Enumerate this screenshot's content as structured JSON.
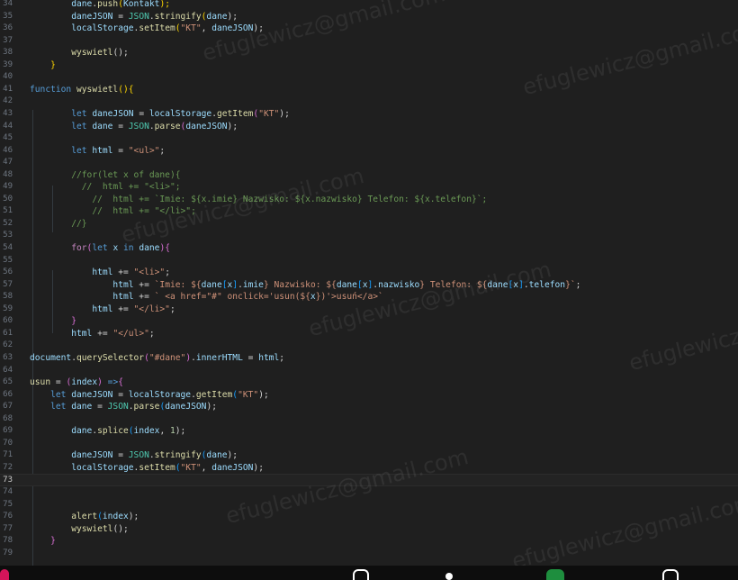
{
  "editor": {
    "lines": [
      {
        "n": "34",
        "t": [
          [
            "        ",
            "p"
          ],
          [
            "dane",
            "var"
          ],
          [
            ".",
            "p"
          ],
          [
            "push",
            "fn"
          ],
          [
            "(",
            "b1"
          ],
          [
            "Kontakt",
            "var"
          ],
          [
            ");",
            "b1"
          ]
        ]
      },
      {
        "n": "35",
        "t": [
          [
            "        ",
            "p"
          ],
          [
            "daneJSON",
            "var"
          ],
          [
            " = ",
            "p"
          ],
          [
            "JSON",
            "cls"
          ],
          [
            ".",
            "p"
          ],
          [
            "stringify",
            "fn"
          ],
          [
            "(",
            "b1"
          ],
          [
            "dane",
            "var"
          ],
          [
            ");",
            "p"
          ]
        ]
      },
      {
        "n": "36",
        "t": [
          [
            "        ",
            "p"
          ],
          [
            "localStorage",
            "var"
          ],
          [
            ".",
            "p"
          ],
          [
            "setItem",
            "fn"
          ],
          [
            "(",
            "b1"
          ],
          [
            "\"KT\"",
            "str"
          ],
          [
            ", ",
            "p"
          ],
          [
            "daneJSON",
            "var"
          ],
          [
            ");",
            "p"
          ]
        ]
      },
      {
        "n": "37",
        "t": []
      },
      {
        "n": "38",
        "t": [
          [
            "        ",
            "p"
          ],
          [
            "wyswietl",
            "fn"
          ],
          [
            "();",
            "p"
          ]
        ]
      },
      {
        "n": "39",
        "t": [
          [
            "    ",
            "p"
          ],
          [
            "}",
            "b1"
          ]
        ]
      },
      {
        "n": "40",
        "t": []
      },
      {
        "n": "41",
        "t": [
          [
            "function",
            "kw"
          ],
          [
            " ",
            "p"
          ],
          [
            "wyswietl",
            "fn"
          ],
          [
            "(){",
            "b1"
          ]
        ]
      },
      {
        "n": "42",
        "t": []
      },
      {
        "n": "43",
        "t": [
          [
            "        ",
            "p"
          ],
          [
            "let",
            "kw"
          ],
          [
            " ",
            "p"
          ],
          [
            "daneJSON",
            "var"
          ],
          [
            " = ",
            "p"
          ],
          [
            "localStorage",
            "var"
          ],
          [
            ".",
            "p"
          ],
          [
            "getItem",
            "fn"
          ],
          [
            "(",
            "b2"
          ],
          [
            "\"KT\"",
            "str"
          ],
          [
            ");",
            "p"
          ]
        ]
      },
      {
        "n": "44",
        "t": [
          [
            "        ",
            "p"
          ],
          [
            "let",
            "kw"
          ],
          [
            " ",
            "p"
          ],
          [
            "dane",
            "var"
          ],
          [
            " = ",
            "p"
          ],
          [
            "JSON",
            "cls"
          ],
          [
            ".",
            "p"
          ],
          [
            "parse",
            "fn"
          ],
          [
            "(",
            "b2"
          ],
          [
            "daneJSON",
            "var"
          ],
          [
            ");",
            "p"
          ]
        ]
      },
      {
        "n": "45",
        "t": []
      },
      {
        "n": "46",
        "t": [
          [
            "        ",
            "p"
          ],
          [
            "let",
            "kw"
          ],
          [
            " ",
            "p"
          ],
          [
            "html",
            "var"
          ],
          [
            " = ",
            "p"
          ],
          [
            "\"<ul>\"",
            "str"
          ],
          [
            ";",
            "p"
          ]
        ]
      },
      {
        "n": "47",
        "t": []
      },
      {
        "n": "48",
        "t": [
          [
            "        ",
            "p"
          ],
          [
            "//for(let x of dane){",
            "cm"
          ]
        ]
      },
      {
        "n": "49",
        "t": [
          [
            "        ",
            "p"
          ],
          [
            "  //  html += \"<li>\";",
            "cm"
          ]
        ]
      },
      {
        "n": "50",
        "t": [
          [
            "        ",
            "p"
          ],
          [
            "    //  html += `Imie: ${x.imie} Nazwisko: ${x.nazwisko} Telefon: ${x.telefon}`;",
            "cm"
          ]
        ]
      },
      {
        "n": "51",
        "t": [
          [
            "        ",
            "p"
          ],
          [
            "    //  html += \"</li>\";",
            "cm"
          ]
        ]
      },
      {
        "n": "52",
        "t": [
          [
            "        ",
            "p"
          ],
          [
            "//}",
            "cm"
          ]
        ]
      },
      {
        "n": "53",
        "t": []
      },
      {
        "n": "54",
        "t": [
          [
            "        ",
            "p"
          ],
          [
            "for",
            "ctl"
          ],
          [
            "(",
            "b2"
          ],
          [
            "let",
            "kw"
          ],
          [
            " ",
            "p"
          ],
          [
            "x",
            "var"
          ],
          [
            " ",
            "p"
          ],
          [
            "in",
            "kw"
          ],
          [
            " ",
            "p"
          ],
          [
            "dane",
            "var"
          ],
          [
            "){",
            "b2"
          ]
        ]
      },
      {
        "n": "55",
        "t": []
      },
      {
        "n": "56",
        "t": [
          [
            "            ",
            "p"
          ],
          [
            "html",
            "var"
          ],
          [
            " += ",
            "p"
          ],
          [
            "\"<li>\"",
            "str"
          ],
          [
            ";",
            "p"
          ]
        ]
      },
      {
        "n": "57",
        "t": [
          [
            "                ",
            "p"
          ],
          [
            "html",
            "var"
          ],
          [
            " += ",
            "p"
          ],
          [
            "`Imie: ${",
            "str"
          ],
          [
            "dane",
            "var"
          ],
          [
            "[",
            "b3"
          ],
          [
            "x",
            "var"
          ],
          [
            "]",
            "b3"
          ],
          [
            ".",
            "p"
          ],
          [
            "imie",
            "var"
          ],
          [
            "} Nazwisko: ${",
            "str"
          ],
          [
            "dane",
            "var"
          ],
          [
            "[",
            "b3"
          ],
          [
            "x",
            "var"
          ],
          [
            "]",
            "b3"
          ],
          [
            ".",
            "p"
          ],
          [
            "nazwisko",
            "var"
          ],
          [
            "} Telefon: ${",
            "str"
          ],
          [
            "dane",
            "var"
          ],
          [
            "[",
            "b3"
          ],
          [
            "x",
            "var"
          ],
          [
            "]",
            "b3"
          ],
          [
            ".",
            "p"
          ],
          [
            "telefon",
            "var"
          ],
          [
            "}`",
            "str"
          ],
          [
            ";",
            "p"
          ]
        ]
      },
      {
        "n": "58",
        "t": [
          [
            "                ",
            "p"
          ],
          [
            "html",
            "var"
          ],
          [
            " += ",
            "p"
          ],
          [
            "` <a href=\"#\" onclick='usun(${",
            "str"
          ],
          [
            "x",
            "var"
          ],
          [
            "})'>usuń</a>`",
            "str"
          ]
        ]
      },
      {
        "n": "59",
        "t": [
          [
            "            ",
            "p"
          ],
          [
            "html",
            "var"
          ],
          [
            " += ",
            "p"
          ],
          [
            "\"</li>\"",
            "str"
          ],
          [
            ";",
            "p"
          ]
        ]
      },
      {
        "n": "60",
        "t": [
          [
            "        ",
            "p"
          ],
          [
            "}",
            "b2"
          ]
        ]
      },
      {
        "n": "61",
        "t": [
          [
            "        ",
            "p"
          ],
          [
            "html",
            "var"
          ],
          [
            " += ",
            "p"
          ],
          [
            "\"</ul>\"",
            "str"
          ],
          [
            ";",
            "p"
          ]
        ]
      },
      {
        "n": "62",
        "t": []
      },
      {
        "n": "63",
        "t": [
          [
            "document",
            "var"
          ],
          [
            ".",
            "p"
          ],
          [
            "querySelector",
            "fn"
          ],
          [
            "(",
            "b2"
          ],
          [
            "\"#dane\"",
            "str"
          ],
          [
            ")",
            "b2"
          ],
          [
            ".",
            "p"
          ],
          [
            "innerHTML",
            "var"
          ],
          [
            " = ",
            "p"
          ],
          [
            "html",
            "var"
          ],
          [
            ";",
            "p"
          ]
        ]
      },
      {
        "n": "64",
        "t": []
      },
      {
        "n": "65",
        "t": [
          [
            "usun",
            "fn"
          ],
          [
            " = ",
            "p"
          ],
          [
            "(",
            "b2"
          ],
          [
            "index",
            "var"
          ],
          [
            ")",
            "b2"
          ],
          [
            " =>",
            "kw"
          ],
          [
            "{",
            "b2"
          ]
        ]
      },
      {
        "n": "66",
        "t": [
          [
            "    ",
            "p"
          ],
          [
            "let",
            "kw"
          ],
          [
            " ",
            "p"
          ],
          [
            "daneJSON",
            "var"
          ],
          [
            " = ",
            "p"
          ],
          [
            "localStorage",
            "var"
          ],
          [
            ".",
            "p"
          ],
          [
            "getItem",
            "fn"
          ],
          [
            "(",
            "b3"
          ],
          [
            "\"KT\"",
            "str"
          ],
          [
            ");",
            "p"
          ]
        ]
      },
      {
        "n": "67",
        "t": [
          [
            "    ",
            "p"
          ],
          [
            "let",
            "kw"
          ],
          [
            " ",
            "p"
          ],
          [
            "dane",
            "var"
          ],
          [
            " = ",
            "p"
          ],
          [
            "JSON",
            "cls"
          ],
          [
            ".",
            "p"
          ],
          [
            "parse",
            "fn"
          ],
          [
            "(",
            "b3"
          ],
          [
            "daneJSON",
            "var"
          ],
          [
            ");",
            "p"
          ]
        ]
      },
      {
        "n": "68",
        "t": []
      },
      {
        "n": "69",
        "t": [
          [
            "        ",
            "p"
          ],
          [
            "dane",
            "var"
          ],
          [
            ".",
            "p"
          ],
          [
            "splice",
            "fn"
          ],
          [
            "(",
            "b3"
          ],
          [
            "index",
            "var"
          ],
          [
            ", ",
            "p"
          ],
          [
            "1",
            "num"
          ],
          [
            ");",
            "p"
          ]
        ]
      },
      {
        "n": "70",
        "t": []
      },
      {
        "n": "71",
        "t": [
          [
            "        ",
            "p"
          ],
          [
            "daneJSON",
            "var"
          ],
          [
            " = ",
            "p"
          ],
          [
            "JSON",
            "cls"
          ],
          [
            ".",
            "p"
          ],
          [
            "stringify",
            "fn"
          ],
          [
            "(",
            "b3"
          ],
          [
            "dane",
            "var"
          ],
          [
            ");",
            "p"
          ]
        ]
      },
      {
        "n": "72",
        "t": [
          [
            "        ",
            "p"
          ],
          [
            "localStorage",
            "var"
          ],
          [
            ".",
            "p"
          ],
          [
            "setItem",
            "fn"
          ],
          [
            "(",
            "b3"
          ],
          [
            "\"KT\"",
            "str"
          ],
          [
            ", ",
            "p"
          ],
          [
            "daneJSON",
            "var"
          ],
          [
            ");",
            "p"
          ]
        ]
      },
      {
        "n": "73",
        "t": [],
        "current": true
      },
      {
        "n": "74",
        "t": []
      },
      {
        "n": "75",
        "t": []
      },
      {
        "n": "76",
        "t": [
          [
            "        ",
            "p"
          ],
          [
            "alert",
            "fn"
          ],
          [
            "(",
            "b3"
          ],
          [
            "index",
            "var"
          ],
          [
            ");",
            "p"
          ]
        ]
      },
      {
        "n": "77",
        "t": [
          [
            "        ",
            "p"
          ],
          [
            "wyswietl",
            "fn"
          ],
          [
            "();",
            "p"
          ]
        ]
      },
      {
        "n": "78",
        "t": [
          [
            "    ",
            "p"
          ],
          [
            "}",
            "b2"
          ]
        ]
      },
      {
        "n": "79",
        "t": []
      }
    ]
  },
  "watermark": {
    "text": "efuglewicz@gmail.com"
  },
  "taskbar": {
    "icons": [
      "app-icon",
      "app-icon",
      "app-icon",
      "app-icon"
    ]
  }
}
